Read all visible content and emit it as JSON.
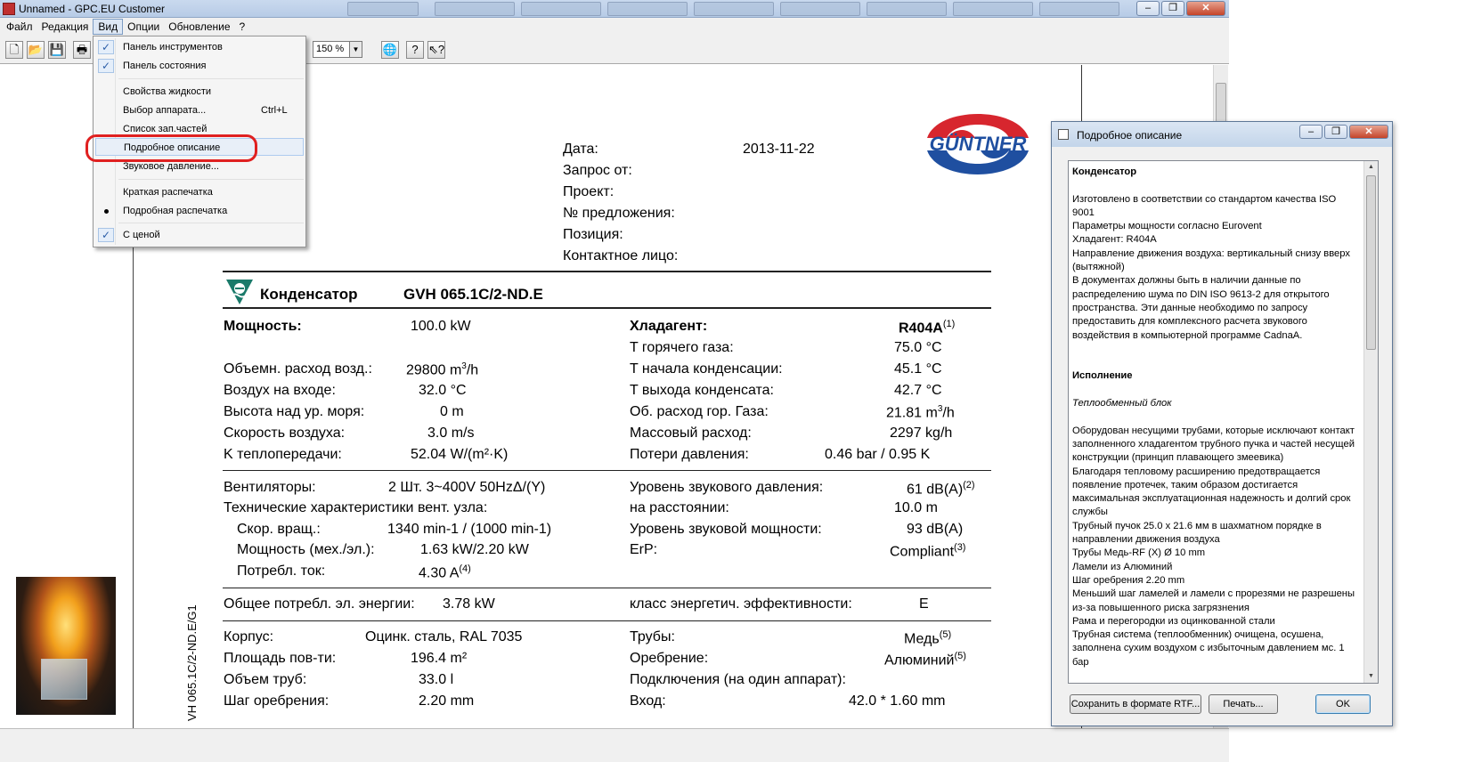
{
  "window": {
    "title": "Unnamed - GPC.EU Customer"
  },
  "menubar": [
    "Файл",
    "Редакция",
    "Вид",
    "Опции",
    "Обновление",
    "?"
  ],
  "toolbar": {
    "zoom": "150 %"
  },
  "view_menu": {
    "items": [
      {
        "label": "Панель инструментов",
        "checked": true
      },
      {
        "label": "Панель состояния",
        "checked": true
      },
      {
        "label": "Свойства жидкости"
      },
      {
        "label": "Выбор аппарата...",
        "shortcut": "Ctrl+L"
      },
      {
        "label": "Список зап.частей"
      },
      {
        "label": "Подробное описание",
        "highlighted": true
      },
      {
        "label": "Звуковое давление..."
      },
      {
        "label": "Краткая распечатка"
      },
      {
        "label": "Подробная распечатка",
        "radio": true
      },
      {
        "label": "С ценой",
        "checked": true
      }
    ]
  },
  "document": {
    "side_label": "VH 065.1C/2-ND.E/G1",
    "logo_text": "GÜNTNER",
    "header": {
      "date_label": "Дата:",
      "date_value": "2013-11-22",
      "request_label": "Запрос от:",
      "project_label": "Проект:",
      "offer_label": "№ предложения:",
      "position_label": "Позиция:",
      "contact_label": "Контактное лицо:"
    },
    "product": {
      "type": "Конденсатор",
      "model": "GVH 065.1C/2-ND.E"
    },
    "perf": {
      "power_label": "Мощность:",
      "power_value": "100.0 kW",
      "airflow_label": "Объемн. расход возд.:",
      "airflow_value": "29800 m",
      "air_in_label": "Воздух на входе:",
      "air_in_value": "32.0 °C",
      "altitude_label": "Высота над ур. моря:",
      "altitude_value": "0 m",
      "air_speed_label": "Скорость воздуха:",
      "air_speed_value": "3.0 m/s",
      "k_label": "K теплопередачи:",
      "k_value": "52.04 W/(m²·K)",
      "refrigerant_label": "Хладагент:",
      "refrigerant_value": "R404A",
      "refrigerant_fn": "(1)",
      "hot_gas_label": "T горячего газа:",
      "hot_gas_value": "75.0 °C",
      "cond_start_label": "T начала конденсации:",
      "cond_start_value": "45.1 °C",
      "cond_out_label": "T выхода конденсата:",
      "cond_out_value": "42.7 °C",
      "gas_flow_label": "Об. расход гор. Газа:",
      "gas_flow_value": "21.81 m",
      "mass_flow_label": "Массовый расход:",
      "mass_flow_value": "2297 kg/h",
      "pressure_drop_label": "Потери давления:",
      "pressure_drop_value": "0.46 bar / 0.95 K"
    },
    "fans": {
      "fans_label": "Вентиляторы:",
      "fans_value": "2 Шт. 3~400V 50HzΔ/(Y)",
      "tech_label": "Технические характеристики вент. узла:",
      "speed_label": "Скор. вращ.:",
      "speed_value": "1340 min-1 / (1000 min-1)",
      "motor_power_label": "Мощность (мех./эл.):",
      "motor_power_value": "1.63 kW/2.20 kW",
      "current_label": "Потребл. ток:",
      "current_value": "4.30 A",
      "current_fn": "(4)",
      "spl_label": "Уровень звукового давления:",
      "spl_value": "61 dB(A)",
      "spl_fn": "(2)",
      "distance_label": "на расстоянии:",
      "distance_value": "10.0 m",
      "swl_label": "Уровень звуковой мощности:",
      "swl_value": "93 dB(A)",
      "erp_label": "ErP:",
      "erp_value": "Compliant",
      "erp_fn": "(3)"
    },
    "energy": {
      "total_label": "Общее потребл. эл. энергии:",
      "total_value": "3.78 kW",
      "class_label": "класс энергетич. эффективности:",
      "class_value": "E"
    },
    "casing": {
      "casing_label": "Корпус:",
      "casing_value": "Оцинк. сталь, RAL 7035",
      "area_label": "Площадь пов-ти:",
      "area_value": "196.4 m²",
      "tube_volume_label": "Объем труб:",
      "tube_volume_value": "33.0 l",
      "fin_pitch_label": "Шаг оребрения:",
      "fin_pitch_value": "2.20 mm",
      "tubes_label": "Трубы:",
      "tubes_value": "Медь",
      "tubes_fn": "(5)",
      "fins_label": "Оребрение:",
      "fins_value": "Алюминий",
      "fins_fn": "(5)",
      "connections_label": "Подключения (на один аппарат):",
      "inlet_label": "Вход:",
      "inlet_value": "42.0 * 1.60 mm"
    }
  },
  "dialog": {
    "title": "Подробное описание",
    "heading1": "Конденсатор",
    "para1": [
      "Изготовлено в соответствии со стандартом качества ISO 9001",
      "Параметры мощности согласно Eurovent",
      "Хладагент: R404A",
      "Направление движения воздуха:  вертикальный снизу вверх (вытяжной)",
      "В документах должны быть в наличии данные по распределению шума по DIN ISO 9613-2 для открытого пространства. Эти данные необходимо по запросу предоставить для комплексного расчета звукового воздействия в компьютерной программе CadnaA."
    ],
    "heading2": "Исполнение",
    "subheading": "Теплообменный блок",
    "para2": [
      "Оборудован несущими трубами, которые исключают контакт заполненного хладагентом трубного пучка и частей несущей конструкции (принцип плавающего змеевика)",
      "Благодаря тепловому расширению предотвращается появление протечек, таким образом достигается максимальная эксплуатационная надежность и долгий срок службы",
      "Трубный пучок  25.0 x 21.6 мм  в шахматном порядке в направлении движения воздуха",
      "Трубы Медь-RF (X) Ø 10 mm",
      "Ламели из Алюминий",
      "Шаг оребрения 2.20 mm",
      "Меньший шаг ламелей и ламели с прорезями не разрешены из-за повышенного риска загрязнения",
      "Рама и перегородки из оцинкованной стали",
      "Трубная система (теплообменник) очищена, осушена, заполнена сухим воздухом с избыточным давлением мс. 1 бар"
    ],
    "save_button": "Сохранить в формате RTF...",
    "print_button": "Печать...",
    "ok_button": "OK"
  }
}
